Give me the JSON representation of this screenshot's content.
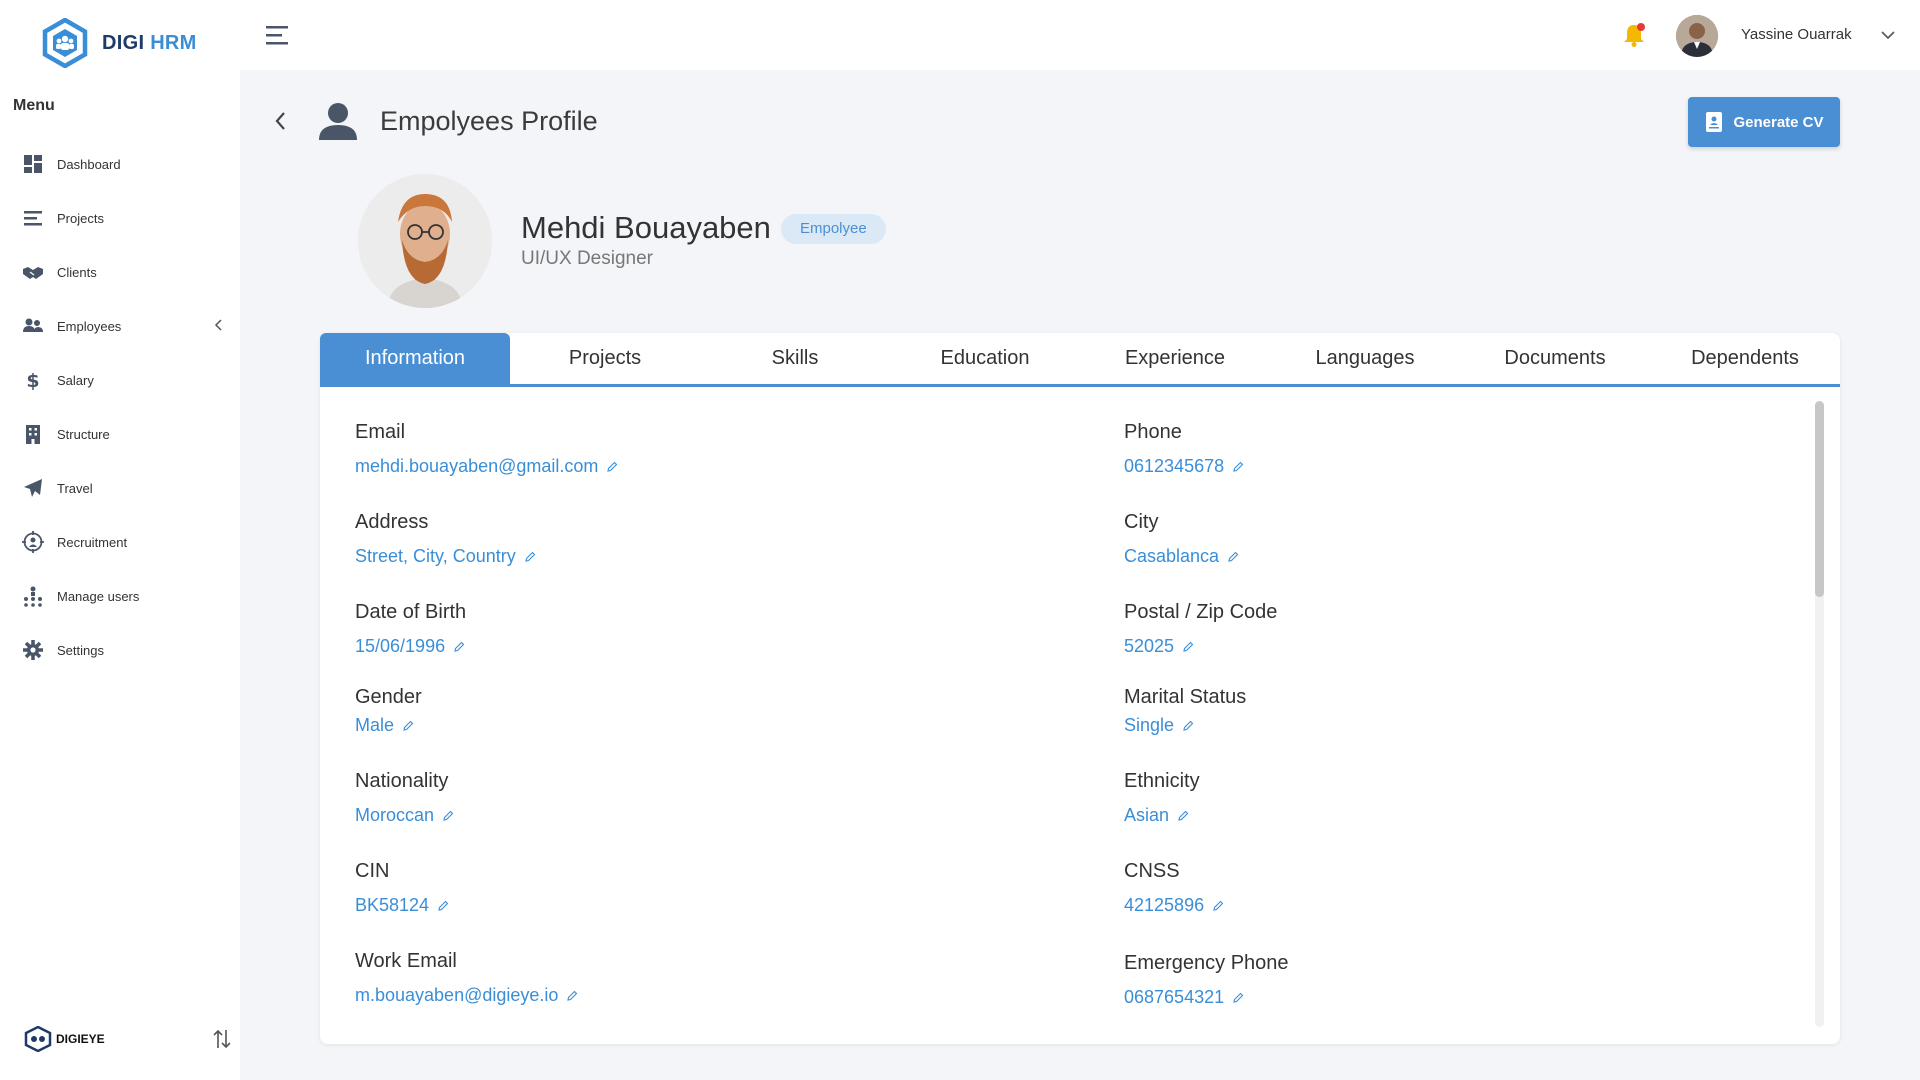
{
  "app": {
    "brand_left": "DIGI",
    "brand_right": "HRM",
    "accent_color": "#4a8fd4"
  },
  "sidebar": {
    "menu_title": "Menu",
    "items": [
      {
        "label": "Dashboard",
        "icon": "dashboard-icon"
      },
      {
        "label": "Projects",
        "icon": "projects-icon"
      },
      {
        "label": "Clients",
        "icon": "handshake-icon"
      },
      {
        "label": "Employees",
        "icon": "employees-icon"
      },
      {
        "label": "Salary",
        "icon": "dollar-icon"
      },
      {
        "label": "Structure",
        "icon": "building-icon"
      },
      {
        "label": "Travel",
        "icon": "plane-icon"
      },
      {
        "label": "Recruitment",
        "icon": "target-icon"
      },
      {
        "label": "Manage users",
        "icon": "org-chart-icon"
      },
      {
        "label": "Settings",
        "icon": "gear-icon"
      }
    ],
    "footer_brand": "DIGIEYE"
  },
  "topbar": {
    "username": "Yassine Ouarrak"
  },
  "page": {
    "title": "Empolyees Profile",
    "generate_cv_label": "Generate CV"
  },
  "profile": {
    "name": "Mehdi Bouayaben",
    "role_badge": "Empolyee",
    "job_title": "UI/UX Designer"
  },
  "tabs": [
    "Information",
    "Projects",
    "Skills",
    "Education",
    "Experience",
    "Languages",
    "Documents",
    "Dependents"
  ],
  "active_tab": "Information",
  "fields": {
    "email": {
      "label": "Email",
      "value": "mehdi.bouayaben@gmail.com"
    },
    "phone": {
      "label": "Phone",
      "value": "0612345678"
    },
    "address": {
      "label": "Address",
      "value": "Street, City, Country"
    },
    "city": {
      "label": "City",
      "value": "Casablanca"
    },
    "dob": {
      "label": "Date of Birth",
      "value": "15/06/1996"
    },
    "postal": {
      "label": "Postal / Zip Code",
      "value": "52025"
    },
    "gender": {
      "label": "Gender",
      "value": "Male"
    },
    "marital": {
      "label": "Marital Status",
      "value": "Single"
    },
    "nationality": {
      "label": "Nationality",
      "value": "Moroccan"
    },
    "ethnicity": {
      "label": "Ethnicity",
      "value": "Asian"
    },
    "cin": {
      "label": "CIN",
      "value": "BK58124"
    },
    "cnss": {
      "label": "CNSS",
      "value": "42125896"
    },
    "work_email": {
      "label": "Work Email",
      "value": "m.bouayaben@digieye.io"
    },
    "emergency_phone": {
      "label": "Emergency Phone",
      "value": "0687654321"
    }
  }
}
